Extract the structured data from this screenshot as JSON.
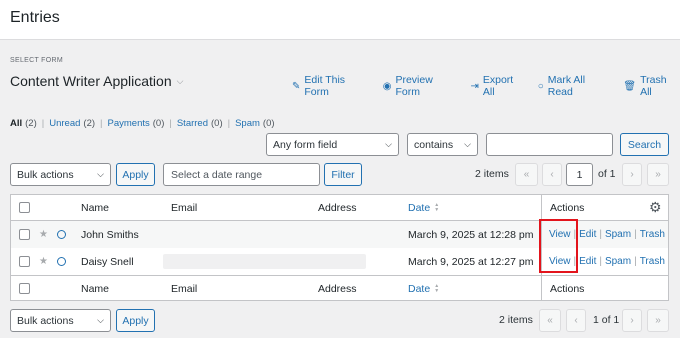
{
  "header": {
    "title": "Entries"
  },
  "form_picker": {
    "label": "SELECT FORM",
    "selected": "Content Writer Application"
  },
  "form_actions": [
    {
      "label": "Edit This Form",
      "icon": "pencil-icon"
    },
    {
      "label": "Preview Form",
      "icon": "eye-icon"
    },
    {
      "label": "Export All",
      "icon": "export-icon"
    },
    {
      "label": "Mark All Read",
      "icon": "circle-icon"
    },
    {
      "label": "Trash All",
      "icon": "trash-icon"
    }
  ],
  "status_links": [
    {
      "label": "All",
      "count": "(2)"
    },
    {
      "label": "Unread",
      "count": "(2)"
    },
    {
      "label": "Payments",
      "count": "(0)"
    },
    {
      "label": "Starred",
      "count": "(0)"
    },
    {
      "label": "Spam",
      "count": "(0)"
    }
  ],
  "search": {
    "field_select": "Any form field",
    "operator_select": "contains",
    "value": "",
    "button": "Search"
  },
  "top_toolbar": {
    "bulk_actions": "Bulk actions",
    "apply": "Apply",
    "date_placeholder": "Select a date range",
    "filter": "Filter",
    "items": "2 items",
    "page_value": "1",
    "of_pages": "of 1"
  },
  "table": {
    "columns": {
      "name": "Name",
      "email": "Email",
      "address": "Address",
      "date": "Date",
      "actions": "Actions"
    },
    "rows": [
      {
        "name": "John Smiths",
        "email": "",
        "address": "",
        "date": "March 9, 2025 at 12:28 pm"
      },
      {
        "name": "Daisy Snell",
        "email": "",
        "address": "",
        "date": "March 9, 2025 at 12:27 pm"
      }
    ],
    "row_actions": {
      "view": "View",
      "edit": "Edit",
      "spam": "Spam",
      "trash": "Trash"
    }
  },
  "bottom_toolbar": {
    "bulk_actions": "Bulk actions",
    "apply": "Apply",
    "items": "2 items",
    "page_text": "1 of 1"
  },
  "colors": {
    "accent": "#2271b1",
    "highlight": "#e3141c"
  }
}
